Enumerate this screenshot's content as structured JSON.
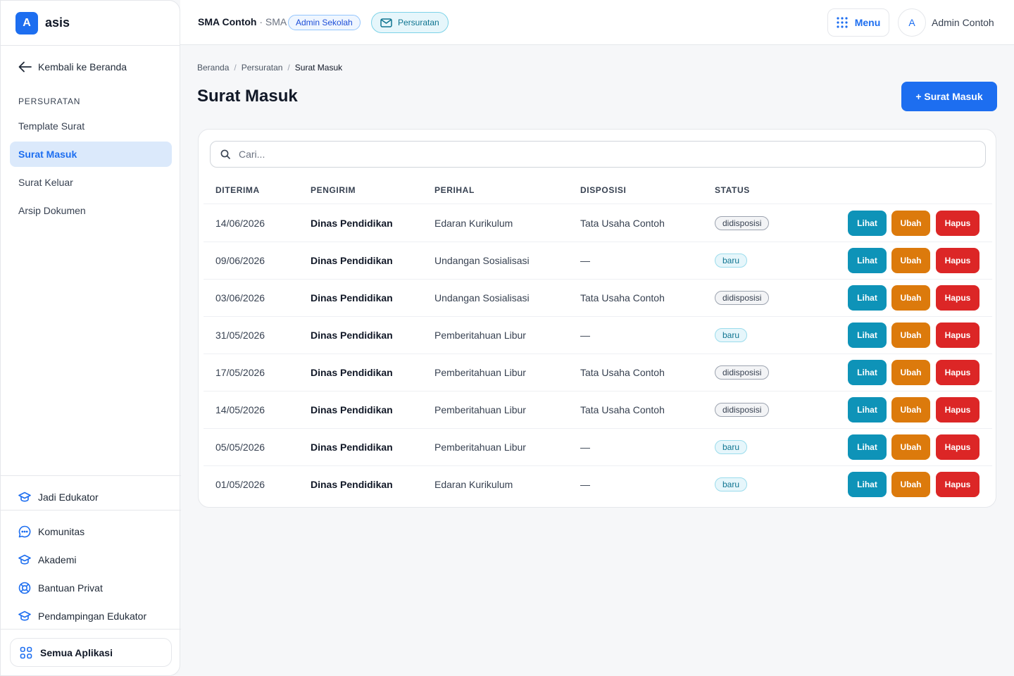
{
  "brand": {
    "logo_letter": "A",
    "name": "asis",
    "color": "#1d6ef0"
  },
  "sidebar": {
    "back_label": "Kembali ke Beranda",
    "section_title": "PERSURATAN",
    "items": [
      {
        "label": "Template Surat",
        "active": false
      },
      {
        "label": "Surat Masuk",
        "active": true
      },
      {
        "label": "Surat Keluar",
        "active": false
      },
      {
        "label": "Arsip Dokumen",
        "active": false
      }
    ],
    "educator_label": "Jadi Edukator",
    "links": [
      {
        "label": "Komunitas",
        "icon": "chat-bubble-icon"
      },
      {
        "label": "Akademi",
        "icon": "graduation-cap-icon"
      },
      {
        "label": "Bantuan Privat",
        "icon": "lifebuoy-icon"
      },
      {
        "label": "Pendampingan Edukator",
        "icon": "graduation-cap-icon"
      }
    ],
    "all_apps_label": "Semua Aplikasi"
  },
  "header": {
    "school_name": "SMA Contoh",
    "school_separator": "·",
    "school_level": "SMA",
    "role_badge": "Admin Sekolah",
    "module_badge": "Persuratan",
    "menu_label": "Menu",
    "avatar_letter": "A",
    "user_name": "Admin Contoh"
  },
  "breadcrumb": [
    "Beranda",
    "Persuratan",
    "Surat Masuk"
  ],
  "page": {
    "title": "Surat Masuk",
    "add_button": "+ Surat Masuk"
  },
  "search": {
    "placeholder": "Cari..."
  },
  "table": {
    "columns": [
      "DITERIMA",
      "PENGIRIM",
      "PERIHAL",
      "DISPOSISI",
      "STATUS"
    ],
    "actions": {
      "view": "Lihat",
      "edit": "Ubah",
      "delete": "Hapus"
    },
    "rows": [
      {
        "date": "14/06/2026",
        "sender": "Dinas Pendidikan",
        "subject": "Edaran Kurikulum",
        "disposition": "Tata Usaha Contoh",
        "status": "didisposisi"
      },
      {
        "date": "09/06/2026",
        "sender": "Dinas Pendidikan",
        "subject": "Undangan Sosialisasi",
        "disposition": "—",
        "status": "baru"
      },
      {
        "date": "03/06/2026",
        "sender": "Dinas Pendidikan",
        "subject": "Undangan Sosialisasi",
        "disposition": "Tata Usaha Contoh",
        "status": "didisposisi"
      },
      {
        "date": "31/05/2026",
        "sender": "Dinas Pendidikan",
        "subject": "Pemberitahuan Libur",
        "disposition": "—",
        "status": "baru"
      },
      {
        "date": "17/05/2026",
        "sender": "Dinas Pendidikan",
        "subject": "Pemberitahuan Libur",
        "disposition": "Tata Usaha Contoh",
        "status": "didisposisi"
      },
      {
        "date": "14/05/2026",
        "sender": "Dinas Pendidikan",
        "subject": "Pemberitahuan Libur",
        "disposition": "Tata Usaha Contoh",
        "status": "didisposisi"
      },
      {
        "date": "05/05/2026",
        "sender": "Dinas Pendidikan",
        "subject": "Pemberitahuan Libur",
        "disposition": "—",
        "status": "baru"
      },
      {
        "date": "01/05/2026",
        "sender": "Dinas Pendidikan",
        "subject": "Edaran Kurikulum",
        "disposition": "—",
        "status": "baru"
      }
    ]
  },
  "colors": {
    "primary": "#1d6ef0",
    "view_button": "#0e93b8",
    "edit_button": "#dc7a0c",
    "delete_button": "#dc2626"
  }
}
